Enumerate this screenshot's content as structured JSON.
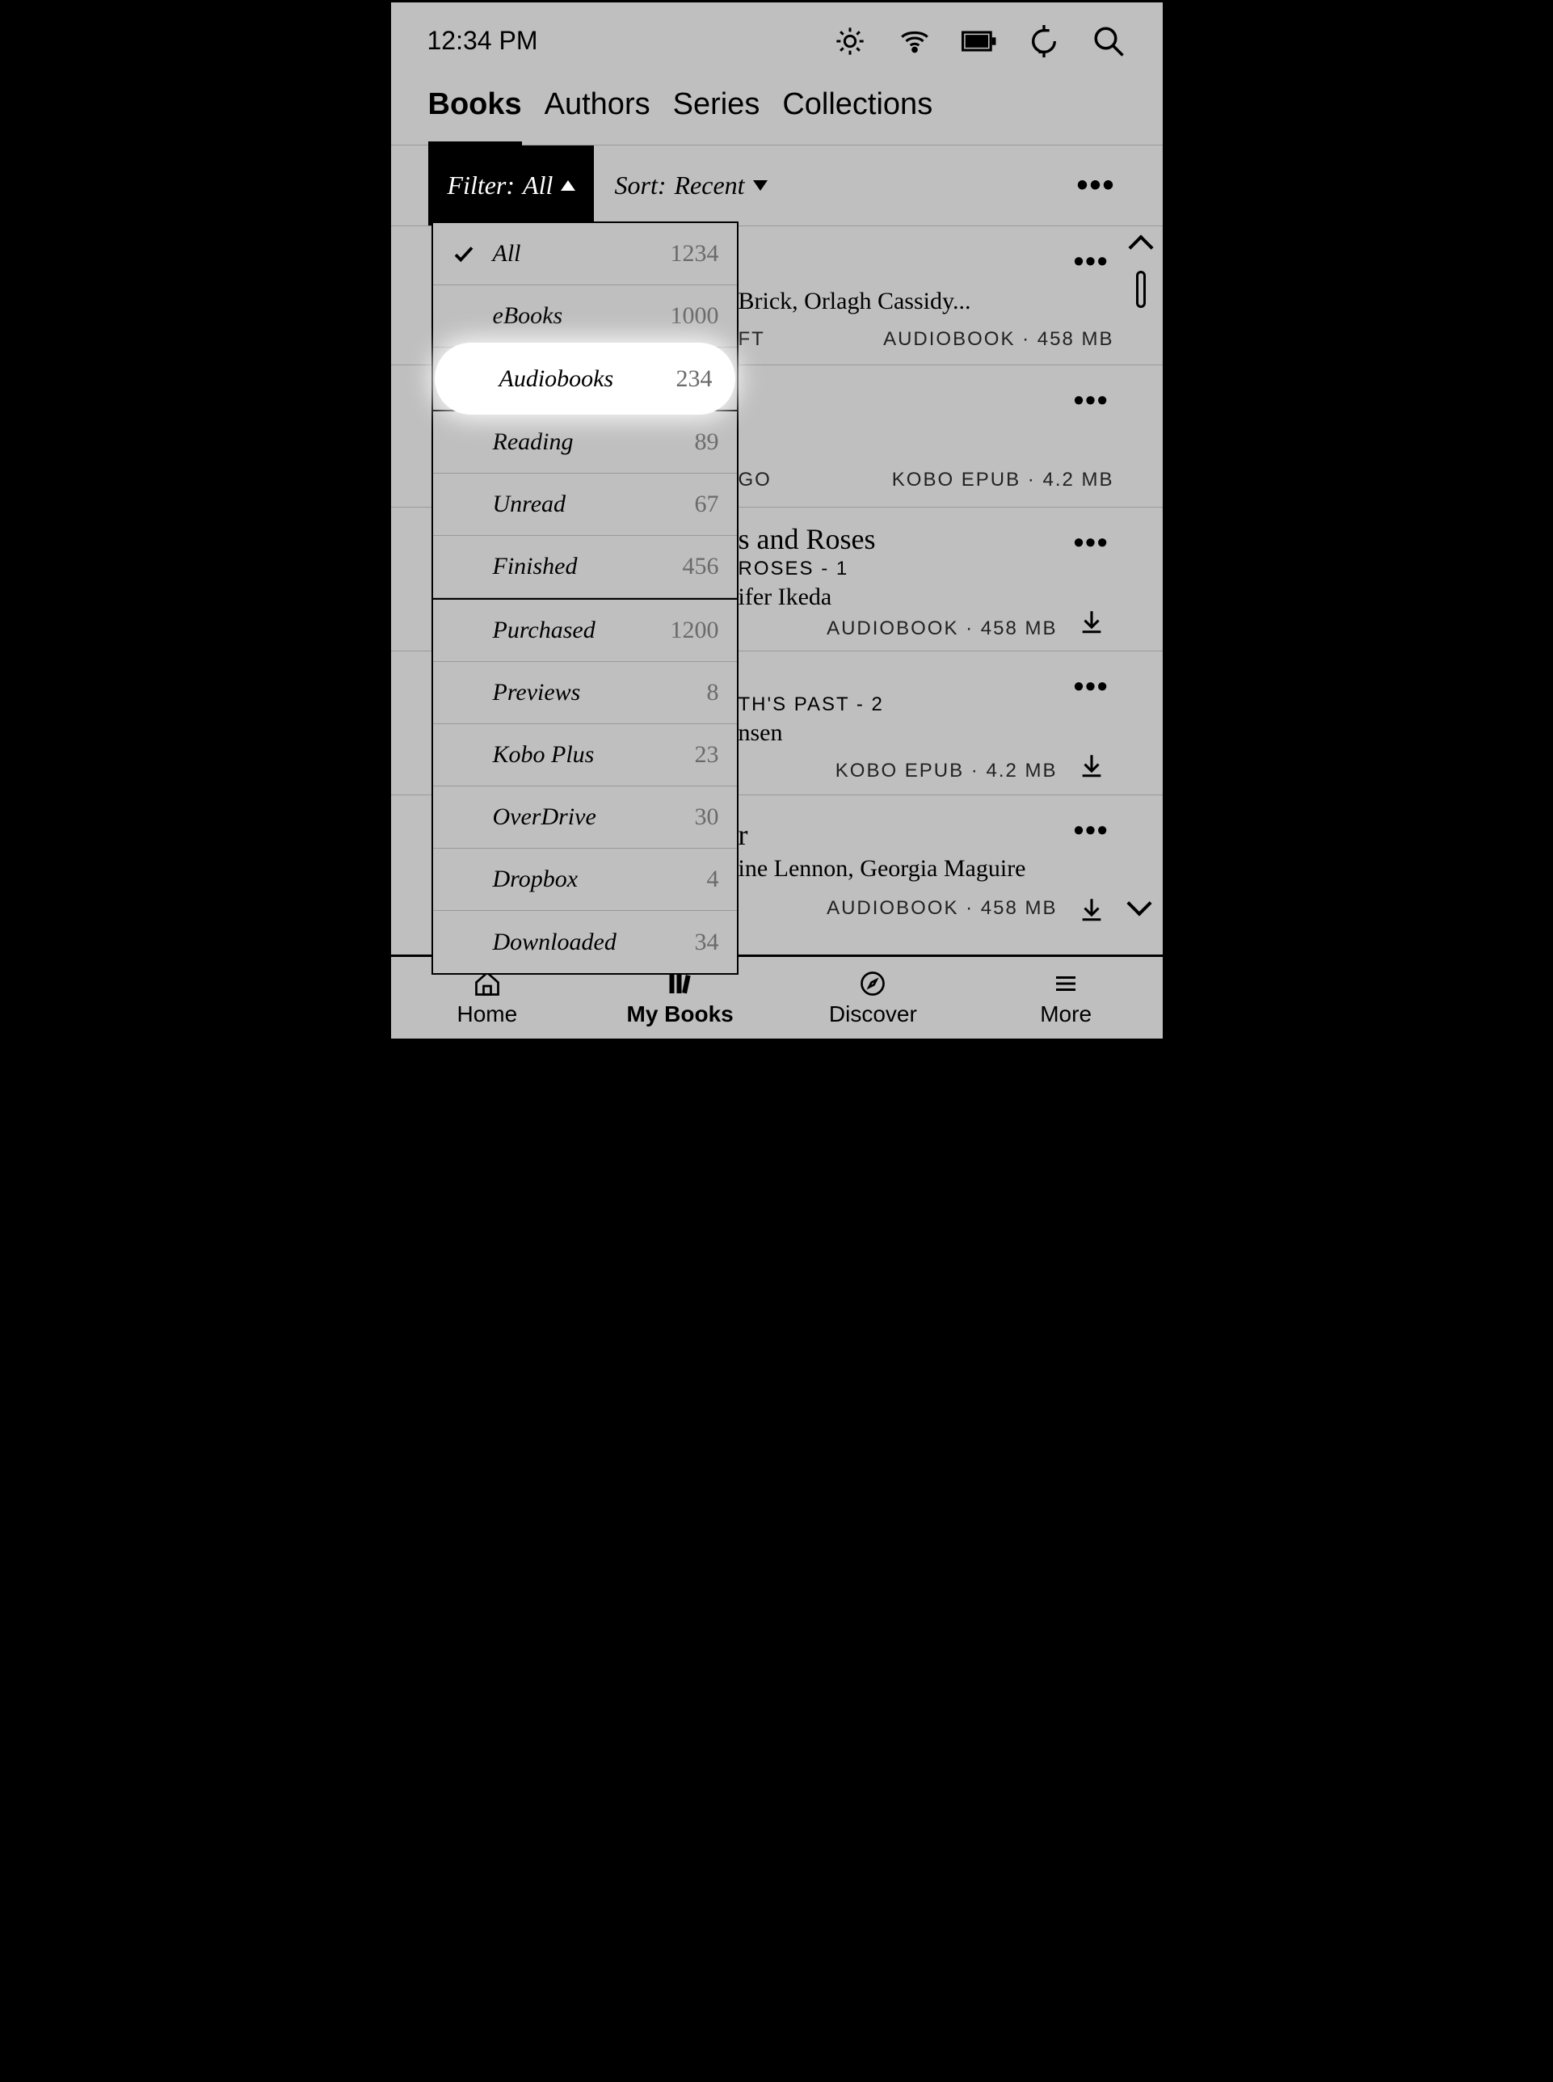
{
  "status": {
    "time": "12:34 PM"
  },
  "tabs": {
    "books": "Books",
    "authors": "Authors",
    "series": "Series",
    "collections": "Collections"
  },
  "tools": {
    "filter_prefix": "Filter: ",
    "filter_value": "All",
    "sort_prefix": "Sort: ",
    "sort_value": "Recent"
  },
  "dropdown": {
    "items": [
      {
        "label": "All",
        "count": "1234",
        "selected": true
      },
      {
        "label": "eBooks",
        "count": "1000"
      },
      {
        "label": "Audiobooks",
        "count": "234",
        "highlight": true
      },
      {
        "label": "Reading",
        "count": "89"
      },
      {
        "label": "Unread",
        "count": "67"
      },
      {
        "label": "Finished",
        "count": "456"
      },
      {
        "label": "Purchased",
        "count": "1200"
      },
      {
        "label": "Previews",
        "count": "8"
      },
      {
        "label": "Kobo Plus",
        "count": "23"
      },
      {
        "label": "OverDrive",
        "count": "30"
      },
      {
        "label": "Dropbox",
        "count": "4"
      },
      {
        "label": "Downloaded",
        "count": "34"
      }
    ]
  },
  "books": [
    {
      "narrator_suffix": " Brick, Orlagh Cassidy...",
      "meta_left_suffix": "FT",
      "meta_right": "AUDIOBOOK · 458 MB",
      "download": false
    },
    {
      "meta_left_suffix": "GO",
      "meta_right": "KOBO EPUB · 4.2 MB",
      "download": false
    },
    {
      "title_suffix": "s and Roses",
      "series_suffix": " ROSES - 1",
      "narrator_suffix": "ifer Ikeda",
      "meta_right": "AUDIOBOOK · 458 MB",
      "download": true
    },
    {
      "series_suffix": "TH'S PAST - 2",
      "narrator_suffix": "nsen",
      "meta_right": "KOBO EPUB · 4.2 MB",
      "download": true
    },
    {
      "title_suffix": "r",
      "narrator_suffix": "ine Lennon, Georgia Maguire",
      "meta_right": "AUDIOBOOK · 458 MB",
      "download": true
    }
  ],
  "nav": {
    "home": "Home",
    "mybooks": "My Books",
    "discover": "Discover",
    "more": "More"
  }
}
